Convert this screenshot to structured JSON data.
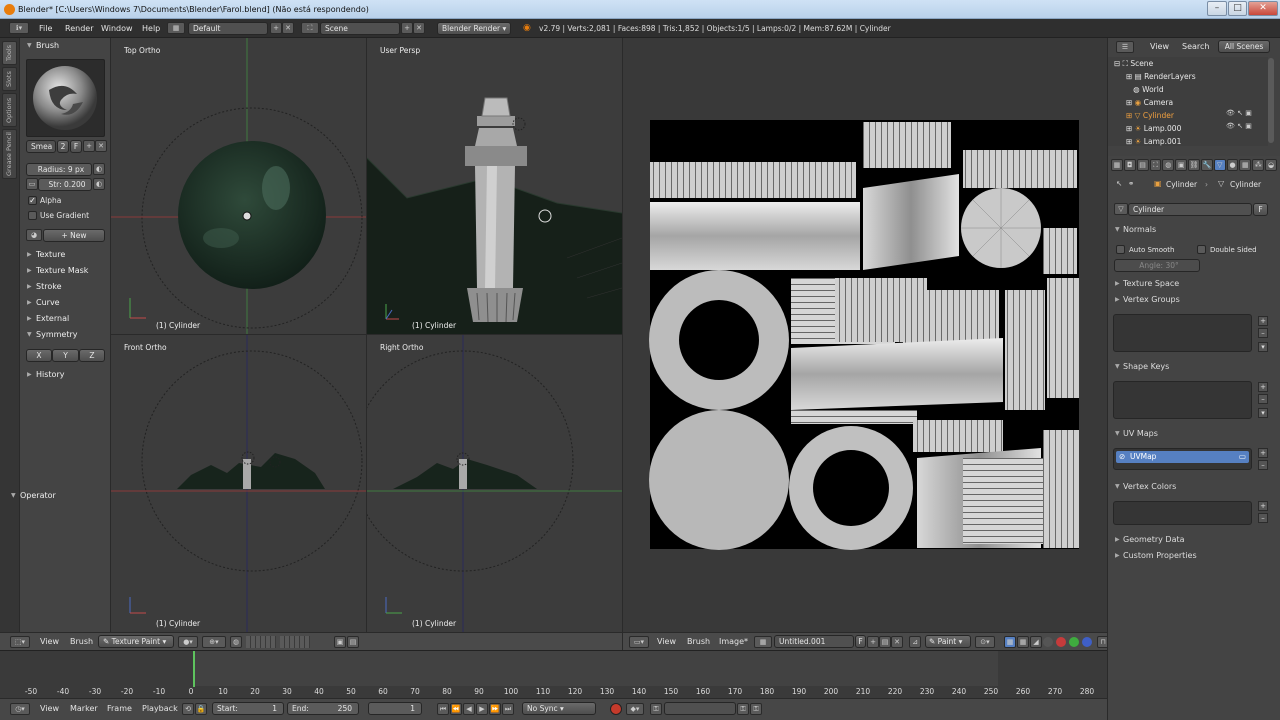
{
  "window": {
    "title": "Blender* [C:\\Users\\Windows 7\\Documents\\Blender\\Farol.blend] (Não está respondendo)"
  },
  "menubar": {
    "menus": [
      "File",
      "Render",
      "Window",
      "Help"
    ],
    "layout": "Default",
    "scene": "Scene",
    "engine": "Blender Render",
    "stats": "v2.79 | Verts:2,081 | Faces:898 | Tris:1,852 | Objects:1/5 | Lamps:0/2 | Mem:87.62M | Cylinder"
  },
  "toolshelf": {
    "tabs": [
      "Tools",
      "Slots",
      "Options",
      "Grease Pencil"
    ],
    "brush_header": "Brush",
    "brush_name": "Smea",
    "brush_users": "2",
    "brush_fake": "F",
    "radius": "Radius: 9 px",
    "strength": "Str: 0.200",
    "alpha_label": "Alpha",
    "use_gradient_label": "Use Gradient",
    "new_button": "New",
    "panels": [
      "Texture",
      "Texture Mask",
      "Stroke",
      "Curve",
      "External"
    ],
    "symmetry": "Symmetry",
    "sym_axes": [
      "X",
      "Y",
      "Z"
    ],
    "history": "History",
    "operator": "Operator"
  },
  "viewports": {
    "top_left": {
      "label": "Top Ortho",
      "object": "(1) Cylinder"
    },
    "top_right": {
      "label": "User Persp",
      "object": "(1) Cylinder"
    },
    "bottom_left": {
      "label": "Front Ortho",
      "object": "(1) Cylinder"
    },
    "bottom_right": {
      "label": "Right Ortho",
      "object": "(1) Cylinder"
    }
  },
  "view3d_header": {
    "menus": [
      "View",
      "Brush"
    ],
    "mode": "Texture Paint"
  },
  "image_editor_header": {
    "menus": [
      "View",
      "Brush",
      "Image*"
    ],
    "image_name": "Untitled.001",
    "fake": "F",
    "paint_mode": "Paint"
  },
  "timeline": {
    "ticks": [
      "-50",
      "-40",
      "-30",
      "-20",
      "-10",
      "0",
      "10",
      "20",
      "30",
      "40",
      "50",
      "60",
      "70",
      "80",
      "90",
      "100",
      "110",
      "120",
      "130",
      "140",
      "150",
      "160",
      "170",
      "180",
      "190",
      "200",
      "210",
      "220",
      "230",
      "240",
      "250",
      "260",
      "270",
      "280"
    ],
    "current_frame_value": 0,
    "menus": [
      "View",
      "Marker",
      "Frame",
      "Playback"
    ],
    "start": "Start:",
    "start_value": "1",
    "end": "End:",
    "end_value": "250",
    "current": "1",
    "sync": "No Sync"
  },
  "outliner": {
    "menus": [
      "View",
      "Search"
    ],
    "filter": "All Scenes",
    "items": [
      "Scene",
      "RenderLayers",
      "World",
      "Camera",
      "Cylinder",
      "Lamp.000",
      "Lamp.001"
    ]
  },
  "properties": {
    "breadcrumb_object": "Cylinder",
    "breadcrumb_mesh": "Cylinder",
    "mesh_name": "Cylinder",
    "fake": "F",
    "normals": "Normals",
    "auto_smooth": "Auto Smooth",
    "double_sided": "Double Sided",
    "angle": "Angle:",
    "angle_value": "30°",
    "sections_closed_a": [
      "Texture Space",
      "Vertex Groups"
    ],
    "shape_keys": "Shape Keys",
    "uv_maps": "UV Maps",
    "uv_map_name": "UVMap",
    "vertex_colors": "Vertex Colors",
    "sections_closed_b": [
      "Geometry Data",
      "Custom Properties"
    ]
  },
  "colors": {
    "accent_selected": "#5680c2",
    "timeline_cursor": "#5ec35e",
    "blender_orange": "#e87d0d"
  }
}
